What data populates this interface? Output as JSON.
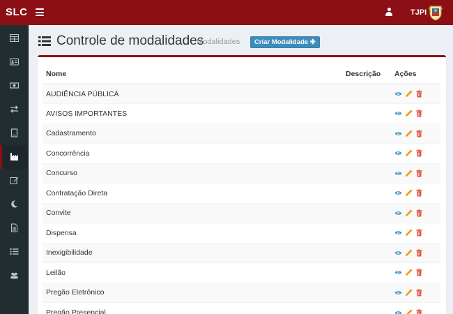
{
  "app": {
    "brand": "SLC",
    "org": "TJPI"
  },
  "colors": {
    "header": "#8b0f14",
    "sidebar": "#222d32",
    "primary": "#3c8dbc",
    "view": "#3c8dbc",
    "edit": "#f39c12",
    "delete": "#dd4b39"
  },
  "sidebar": {
    "items": [
      {
        "icon": "table-icon"
      },
      {
        "icon": "id-card-icon"
      },
      {
        "icon": "money-icon"
      },
      {
        "icon": "exchange-icon"
      },
      {
        "icon": "book-icon"
      },
      {
        "icon": "industry-icon",
        "active": true
      },
      {
        "icon": "edit-icon"
      },
      {
        "icon": "moon-icon"
      },
      {
        "icon": "file-icon"
      },
      {
        "icon": "list-icon"
      },
      {
        "icon": "users-icon"
      }
    ]
  },
  "header": {
    "title": "Controle de modalidades",
    "subtitle": "Modalidades",
    "create_label": "Criar Modalidade"
  },
  "table": {
    "columns": {
      "name": "Nome",
      "description": "Descrição",
      "actions": "Ações"
    },
    "rows": [
      "AUDIÊNCIA PÚBLICA",
      "AVISOS IMPORTANTES",
      "Cadastramento",
      "Concorrência",
      "Concurso",
      "Contratação Direta",
      "Convite",
      "Dispensa",
      "Inexigibilidade",
      "Leilão",
      "Pregão Eletrônico",
      "Pregão Presencial"
    ]
  }
}
